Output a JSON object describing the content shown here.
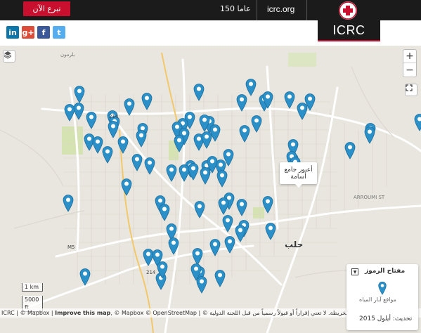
{
  "header": {
    "donate_label": "تبرع الآن",
    "years_label": "150 عاما",
    "site_label": "icrc.org",
    "logo_text": "ICRC"
  },
  "social": {
    "linkedin": "in",
    "googleplus": "g+",
    "facebook": "f",
    "twitter": "t"
  },
  "map": {
    "tooltip": "أعبور جامع أسامة",
    "city_label": "حلب",
    "street_labels": [
      "بلرمون",
      "ARROUMI ST"
    ],
    "road_numbers": [
      "214",
      "214",
      "M5"
    ],
    "scale_km": "1 km",
    "scale_ft": "5000 ft",
    "zoom_in": "+",
    "zoom_out": "−",
    "pin_count": 98,
    "colors": {
      "pin": "#2b8fc8",
      "road_major": "#ffffff",
      "road_minor": "#dcd8cf",
      "park": "#cfe2a8",
      "background": "#e9e6df"
    }
  },
  "legend": {
    "title": "مفتاح الرموز",
    "item_label": "مواقع آبار المياه",
    "update_label": "تحديث: أيلول 2015"
  },
  "attribution": {
    "prefix": "ICRC | © Mapbox | ",
    "improve": "Improve this map",
    "suffix": ", © Mapbox © OpenStreetMap | © ",
    "disclaimer": "مستخدمة في هذه الخريطة. لا تعني إقراراً أو قبولاً رسمياً من قبل اللجنة الدولية"
  }
}
